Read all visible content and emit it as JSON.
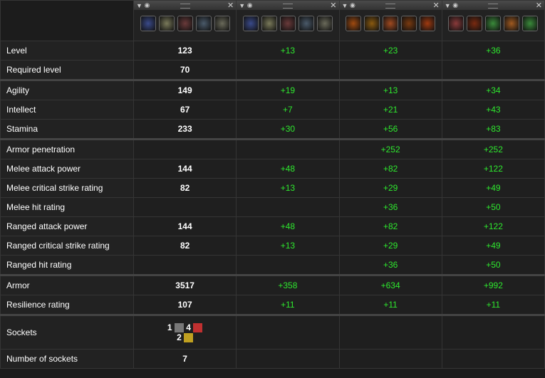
{
  "columns": [
    {
      "icons": [
        "#3a4a8a",
        "#7a7a5a",
        "#6a3a3a",
        "#4a5a6a",
        "#6a6a5a"
      ],
      "eye": "eye-icon"
    },
    {
      "icons": [
        "#3a4a8a",
        "#7a7a5a",
        "#6a3a3a",
        "#4a5a6a",
        "#6a6a5a"
      ],
      "eye": "eye-icon"
    },
    {
      "icons": [
        "#a04a10",
        "#8a5a10",
        "#a04a20",
        "#7a3a10",
        "#a03a10"
      ],
      "eye": "eye-icon"
    },
    {
      "icons": [
        "#8a3a3a",
        "#7a2a10",
        "#3a8a3a",
        "#a05a20",
        "#3a8a3a"
      ],
      "eye": "eye-icon"
    }
  ],
  "colors": {
    "green": "#2ee82e",
    "socket_gray": "#777777",
    "socket_red": "#c03030",
    "socket_yellow": "#c0a020"
  },
  "rows": [
    {
      "label": "Level",
      "values": [
        "123",
        "+13",
        "+23",
        "+36"
      ]
    },
    {
      "label": "Required level",
      "values": [
        "70",
        "",
        "",
        ""
      ]
    },
    {
      "label": "Agility",
      "values": [
        "149",
        "+19",
        "+13",
        "+34"
      ],
      "sep": true
    },
    {
      "label": "Intellect",
      "values": [
        "67",
        "+7",
        "+21",
        "+43"
      ]
    },
    {
      "label": "Stamina",
      "values": [
        "233",
        "+30",
        "+56",
        "+83"
      ]
    },
    {
      "label": "Armor penetration",
      "values": [
        "",
        "",
        "+252",
        "+252"
      ],
      "sep": true
    },
    {
      "label": "Melee attack power",
      "values": [
        "144",
        "+48",
        "+82",
        "+122"
      ]
    },
    {
      "label": "Melee critical strike rating",
      "values": [
        "82",
        "+13",
        "+29",
        "+49"
      ]
    },
    {
      "label": "Melee hit rating",
      "values": [
        "",
        "",
        "+36",
        "+50"
      ]
    },
    {
      "label": "Ranged attack power",
      "values": [
        "144",
        "+48",
        "+82",
        "+122"
      ]
    },
    {
      "label": "Ranged critical strike rating",
      "values": [
        "82",
        "+13",
        "+29",
        "+49"
      ]
    },
    {
      "label": "Ranged hit rating",
      "values": [
        "",
        "",
        "+36",
        "+50"
      ]
    },
    {
      "label": "Armor",
      "values": [
        "3517",
        "+358",
        "+634",
        "+992"
      ],
      "sep": true
    },
    {
      "label": "Resilience rating",
      "values": [
        "107",
        "+11",
        "+11",
        "+11"
      ]
    }
  ],
  "sockets": {
    "label": "Sockets",
    "items": [
      {
        "count": "1",
        "color": "gray"
      },
      {
        "count": "4",
        "color": "red"
      },
      {
        "count": "2",
        "color": "yellow"
      }
    ]
  },
  "number_of_sockets": {
    "label": "Number of sockets",
    "value": "7"
  }
}
